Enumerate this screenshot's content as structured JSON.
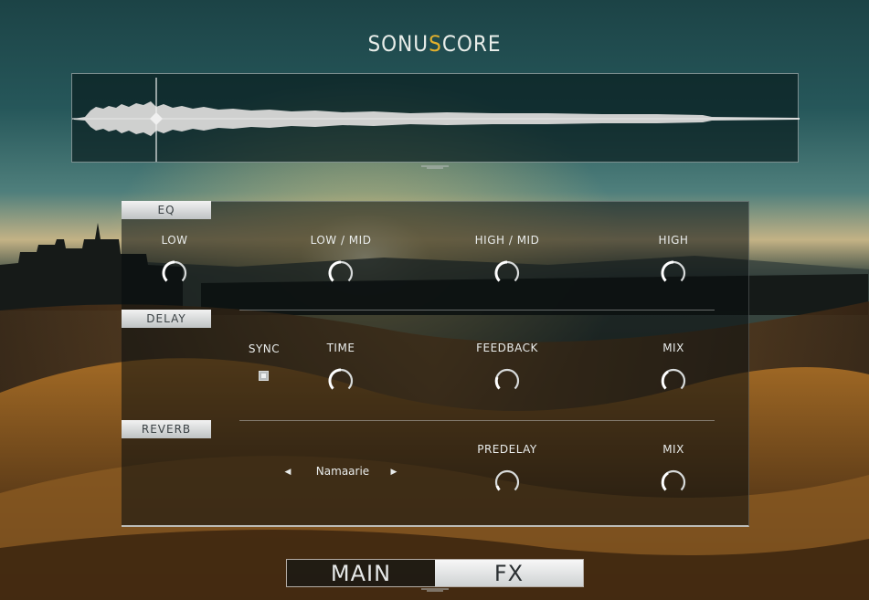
{
  "header": {
    "logo_prefix": "SONU",
    "logo_accent": "S",
    "logo_suffix": "CORE"
  },
  "colors": {
    "accent": "#e3b02c",
    "panel_text": "#e9eceb",
    "tab_active_bg": "#e6e8e8"
  },
  "eq": {
    "title": "EQ",
    "knobs": [
      {
        "label": "LOW"
      },
      {
        "label": "LOW / MID"
      },
      {
        "label": "HIGH / MID"
      },
      {
        "label": "HIGH"
      }
    ]
  },
  "delay": {
    "title": "DELAY",
    "sync_label": "SYNC",
    "knobs": [
      {
        "label": "TIME"
      },
      {
        "label": "FEEDBACK"
      },
      {
        "label": "MIX"
      }
    ]
  },
  "reverb": {
    "title": "REVERB",
    "preset": "Namaarie",
    "knobs": [
      {
        "label": "PREDELAY"
      },
      {
        "label": "MIX"
      }
    ]
  },
  "tabs": {
    "main": "MAIN",
    "fx": "FX"
  }
}
